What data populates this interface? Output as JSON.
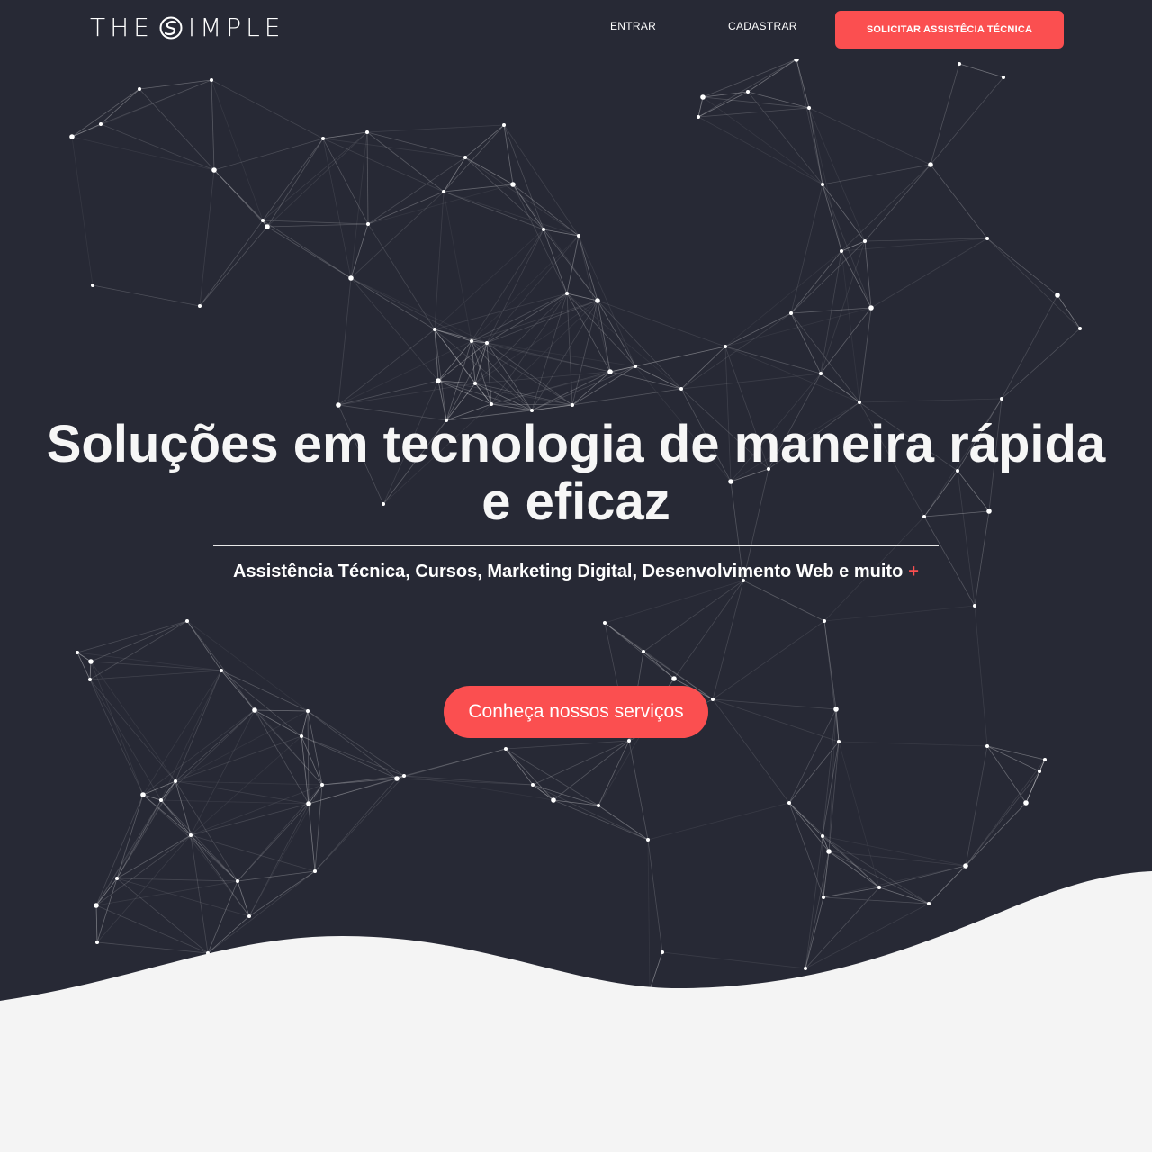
{
  "header": {
    "logo": {
      "text_left": "THE",
      "text_right": "IMPLE"
    },
    "nav": [
      {
        "label": "ENTRAR"
      },
      {
        "label": "CADASTRAR"
      }
    ],
    "cta_label": "SOLICITAR ASSISTÊCIA TÉCNICA"
  },
  "hero": {
    "headline": "Soluções em tecnologia de maneira rápida e eficaz",
    "subheadline": "Assistência Técnica, Cursos, Marketing Digital, Desenvolvimento Web e muito",
    "plus_sign": "+",
    "cta_label": "Conheça nossos serviços"
  },
  "colors": {
    "hero_background": "#272935",
    "accent": "#fb4f50",
    "page_background": "#f4f4f4",
    "text_light": "#ffffff"
  }
}
